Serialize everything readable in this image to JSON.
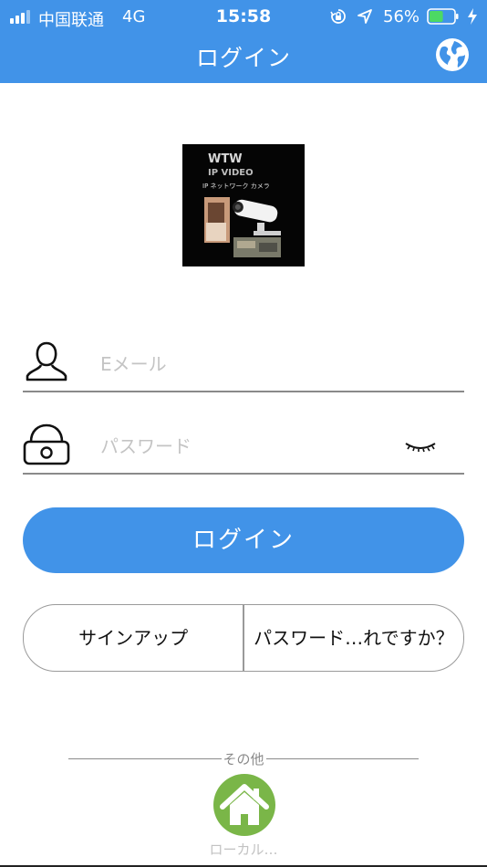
{
  "status_bar": {
    "carrier": "中国联通",
    "network": "4G",
    "time": "15:58",
    "battery_percent": "56%",
    "battery_level": 0.56
  },
  "nav": {
    "title": "ログイン",
    "right_icon": "globe-icon"
  },
  "logo": {
    "text_lines": [
      "WTW",
      "IP VIDEO",
      "IP ネットワーク カメラ"
    ]
  },
  "form": {
    "email": {
      "placeholder": "Eメール",
      "value": "",
      "icon": "user-icon"
    },
    "password": {
      "placeholder": "パスワード",
      "value": "",
      "icon": "lock-icon",
      "toggle_icon": "eye-closed-icon"
    }
  },
  "buttons": {
    "login": "ログイン",
    "signup": "サインアップ",
    "forgot": "パスワード…れですか？"
  },
  "other": {
    "divider_label": "その他",
    "local_label": "ローカル…",
    "local_icon": "home-icon"
  },
  "colors": {
    "primary": "#4193e8",
    "home_green": "#7ab648",
    "placeholder": "#c4c4c4"
  }
}
